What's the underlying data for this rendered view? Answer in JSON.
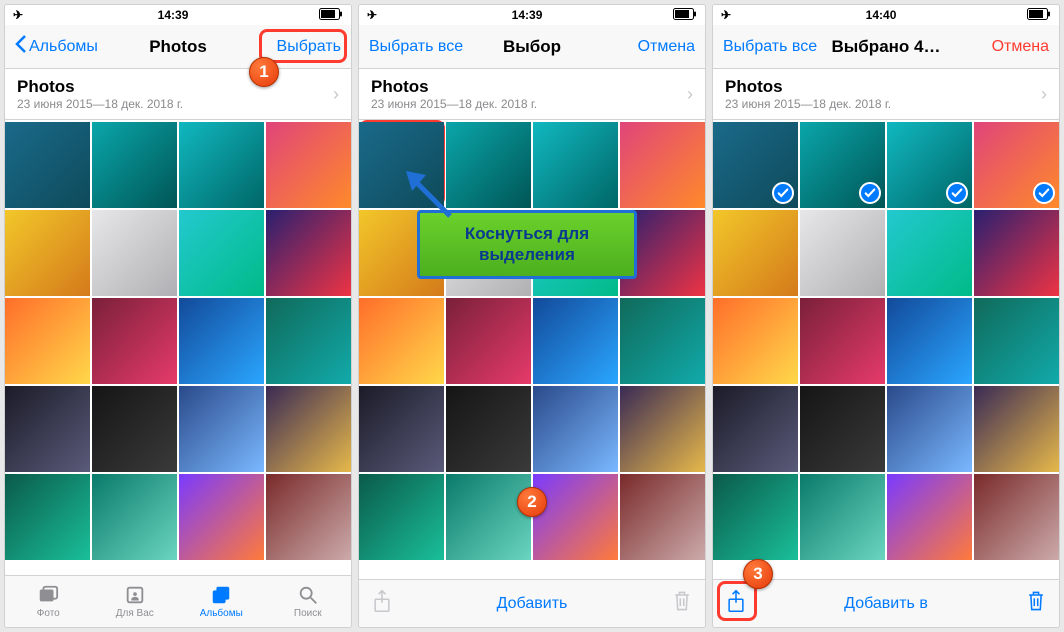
{
  "screens": [
    {
      "status": {
        "time": "14:39"
      },
      "nav": {
        "back": "Альбомы",
        "title": "Photos",
        "right": "Выбрать"
      },
      "section": {
        "title": "Photos",
        "sub": "23 июня 2015—18 дек. 2018 г."
      },
      "tabs": [
        {
          "label": "Фото"
        },
        {
          "label": "Для Вас"
        },
        {
          "label": "Альбомы"
        },
        {
          "label": "Поиск"
        }
      ],
      "highlight": {
        "target": "select-button"
      },
      "step": "1"
    },
    {
      "status": {
        "time": "14:39"
      },
      "nav": {
        "left": "Выбрать все",
        "title": "Выбор",
        "right": "Отмена"
      },
      "section": {
        "title": "Photos",
        "sub": "23 июня 2015—18 дек. 2018 г."
      },
      "toolbar": {
        "center": "Добавить"
      },
      "highlight": {
        "target": "first-thumb"
      },
      "callout": "Коснуться для выделения",
      "step": "2"
    },
    {
      "status": {
        "time": "14:40"
      },
      "nav": {
        "left": "Выбрать все",
        "title": "Выбрано 4…",
        "right": "Отмена"
      },
      "section": {
        "title": "Photos",
        "sub": "23 июня 2015—18 дек. 2018 г."
      },
      "toolbar": {
        "center": "Добавить в"
      },
      "selected_count": 4,
      "highlight": {
        "target": "share-button"
      },
      "step": "3"
    }
  ],
  "thumb_colors": [
    [
      "#1a6a8a",
      "#0e4a5a"
    ],
    [
      "#0aa6aa",
      "#055"
    ],
    [
      "#10b8c0",
      "#066"
    ],
    [
      "#e0447a",
      "#ff8a2a"
    ],
    [
      "#f2c72a",
      "#d47a1a"
    ],
    [
      "#e7e7e9",
      "#b0b0b3"
    ],
    [
      "#23c9cf",
      "#0b8"
    ],
    [
      "#2a2070",
      "#e34"
    ],
    [
      "#ff6e2a",
      "#ffd84a"
    ],
    [
      "#7a203a",
      "#e63a6a"
    ],
    [
      "#124a9a",
      "#2aa6ff"
    ],
    [
      "#106a5a",
      "#1aa"
    ],
    [
      "#1b1b28",
      "#5a5a7a"
    ],
    [
      "#151515",
      "#3a3a3a"
    ],
    [
      "#2a4a8a",
      "#7ab8ff"
    ],
    [
      "#3a2a55",
      "#e6b84a"
    ],
    [
      "#0a5a4a",
      "#1abf9a"
    ],
    [
      "#0a7a6a",
      "#6ad6c0"
    ],
    [
      "#7a3aff",
      "#ff7a3a"
    ],
    [
      "#7a2a2a",
      "#caa"
    ]
  ]
}
